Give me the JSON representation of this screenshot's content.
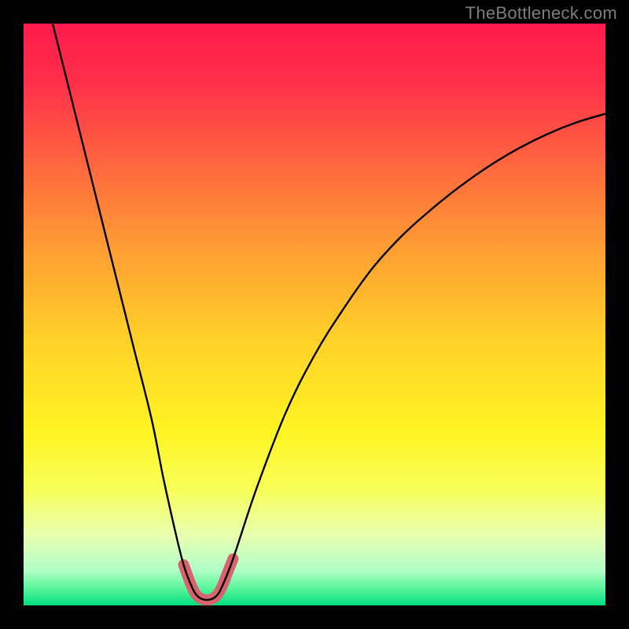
{
  "watermark": "TheBottleneck.com",
  "chart_data": {
    "type": "line",
    "title": "",
    "xlabel": "",
    "ylabel": "",
    "xlim": [
      0,
      100
    ],
    "ylim": [
      0,
      100
    ],
    "background_gradient": {
      "stops": [
        {
          "offset": 0,
          "color": "#ff1a4b"
        },
        {
          "offset": 0.1,
          "color": "#ff2f4a"
        },
        {
          "offset": 0.25,
          "color": "#ff6a3e"
        },
        {
          "offset": 0.4,
          "color": "#ffa232"
        },
        {
          "offset": 0.55,
          "color": "#ffd328"
        },
        {
          "offset": 0.7,
          "color": "#fff423"
        },
        {
          "offset": 0.8,
          "color": "#f8ff58"
        },
        {
          "offset": 0.88,
          "color": "#e8ffb0"
        },
        {
          "offset": 0.94,
          "color": "#b0ffc8"
        },
        {
          "offset": 0.97,
          "color": "#5cf59c"
        },
        {
          "offset": 1.0,
          "color": "#00e07f"
        }
      ]
    },
    "series": [
      {
        "name": "bottleneck-curve",
        "color": "#000000",
        "stroke_width": 2.4,
        "points": [
          {
            "x": 5.0,
            "y": 100.0
          },
          {
            "x": 7.0,
            "y": 92.0
          },
          {
            "x": 10.0,
            "y": 80.0
          },
          {
            "x": 13.0,
            "y": 68.0
          },
          {
            "x": 16.0,
            "y": 56.0
          },
          {
            "x": 19.0,
            "y": 44.0
          },
          {
            "x": 22.0,
            "y": 32.0
          },
          {
            "x": 24.0,
            "y": 22.0
          },
          {
            "x": 26.0,
            "y": 13.0
          },
          {
            "x": 27.5,
            "y": 7.0
          },
          {
            "x": 29.0,
            "y": 3.0
          },
          {
            "x": 30.0,
            "y": 1.5
          },
          {
            "x": 31.0,
            "y": 1.0
          },
          {
            "x": 32.0,
            "y": 1.0
          },
          {
            "x": 33.0,
            "y": 1.5
          },
          {
            "x": 34.0,
            "y": 3.0
          },
          {
            "x": 36.0,
            "y": 8.0
          },
          {
            "x": 40.0,
            "y": 20.0
          },
          {
            "x": 45.0,
            "y": 33.0
          },
          {
            "x": 50.0,
            "y": 43.0
          },
          {
            "x": 55.0,
            "y": 51.0
          },
          {
            "x": 60.0,
            "y": 58.0
          },
          {
            "x": 65.0,
            "y": 63.5
          },
          {
            "x": 70.0,
            "y": 68.0
          },
          {
            "x": 75.0,
            "y": 72.0
          },
          {
            "x": 80.0,
            "y": 75.5
          },
          {
            "x": 85.0,
            "y": 78.5
          },
          {
            "x": 90.0,
            "y": 81.0
          },
          {
            "x": 95.0,
            "y": 83.0
          },
          {
            "x": 100.0,
            "y": 84.5
          }
        ]
      },
      {
        "name": "sweet-spot-band",
        "color": "#d9626f",
        "stroke_width": 14,
        "points": [
          {
            "x": 27.5,
            "y": 7.0
          },
          {
            "x": 29.0,
            "y": 3.0
          },
          {
            "x": 30.0,
            "y": 1.5
          },
          {
            "x": 31.0,
            "y": 1.0
          },
          {
            "x": 32.0,
            "y": 1.0
          },
          {
            "x": 33.0,
            "y": 1.5
          },
          {
            "x": 34.0,
            "y": 3.0
          },
          {
            "x": 35.0,
            "y": 5.5
          },
          {
            "x": 36.0,
            "y": 8.0
          }
        ]
      }
    ]
  }
}
